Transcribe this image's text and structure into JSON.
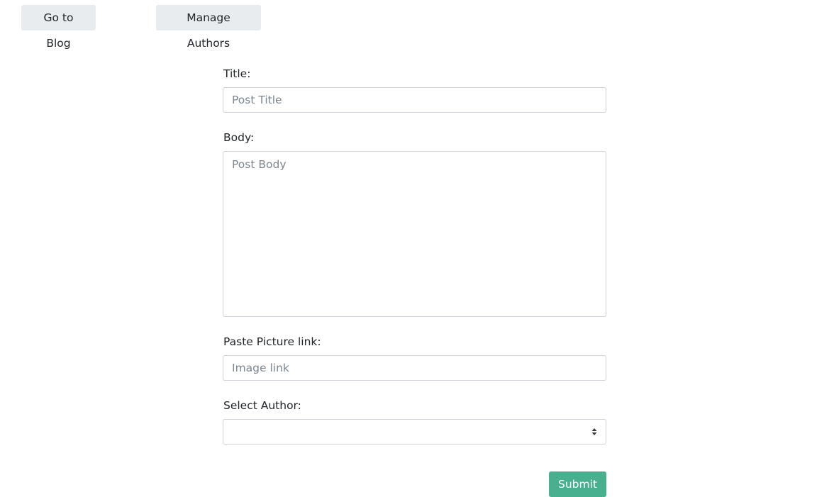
{
  "nav": {
    "blog_label": "Go to Blog",
    "authors_label": "Manage Authors"
  },
  "form": {
    "title_label": "Title:",
    "title_placeholder": "Post Title",
    "title_value": "",
    "body_label": "Body:",
    "body_placeholder": "Post Body",
    "body_value": "",
    "image_label": "Paste Picture link:",
    "image_placeholder": "Image link",
    "image_value": "",
    "author_label": "Select Author:",
    "author_selected": "",
    "submit_label": "Submit"
  },
  "icons": {
    "select_caret": "select-caret-icon"
  },
  "colors": {
    "nav_button_bg": "#e9ecef",
    "submit_bg": "#48b08f",
    "field_border": "#ced4da"
  }
}
